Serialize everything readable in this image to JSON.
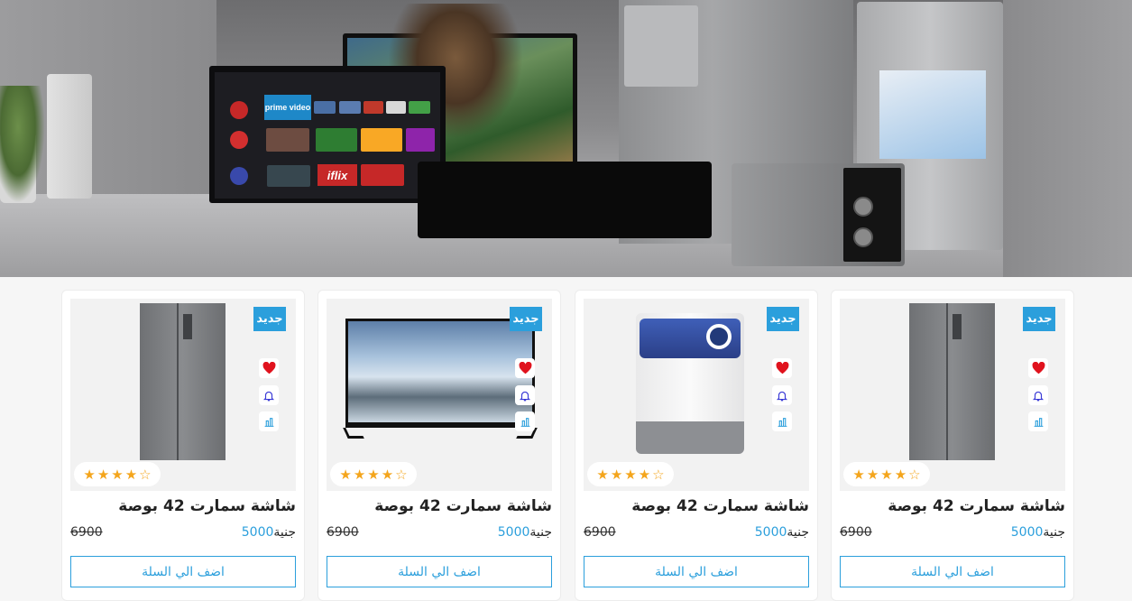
{
  "colors": {
    "accent": "#2b9fdc",
    "badge_bg": "#2b9fdc",
    "star": "#f4a51c",
    "heart": "#e0121d",
    "bell": "#3a3ad6"
  },
  "hero": {
    "tv_apps": {
      "prime": "prime video",
      "iflix": "iflix"
    }
  },
  "products": [
    {
      "badge": "جديد",
      "image": "fridge",
      "title": "شاشة سمارت 42 بوصة",
      "old_price": "6900",
      "new_price": "5000",
      "currency": "جنية",
      "rating": 4,
      "max_rating": 5,
      "add_to_cart": "اضف الي السلة"
    },
    {
      "badge": "جديد",
      "image": "washing-machine",
      "title": "شاشة سمارت 42 بوصة",
      "old_price": "6900",
      "new_price": "5000",
      "currency": "جنية",
      "rating": 4,
      "max_rating": 5,
      "add_to_cart": "اضف الي السلة"
    },
    {
      "badge": "جديد",
      "image": "tv",
      "title": "شاشة سمارت 42 بوصة",
      "old_price": "6900",
      "new_price": "5000",
      "currency": "جنية",
      "rating": 4,
      "max_rating": 5,
      "add_to_cart": "اضف الي السلة"
    },
    {
      "badge": "جديد",
      "image": "fridge",
      "title": "شاشة سمارت 42 بوصة",
      "old_price": "6900",
      "new_price": "5000",
      "currency": "جنية",
      "rating": 4,
      "max_rating": 5,
      "add_to_cart": "اضف الي السلة"
    }
  ],
  "icons": {
    "wishlist": "heart-icon",
    "notify": "bell-icon",
    "compare": "compare-icon",
    "star_full": "star-icon",
    "star_empty": "star-outline-icon"
  }
}
